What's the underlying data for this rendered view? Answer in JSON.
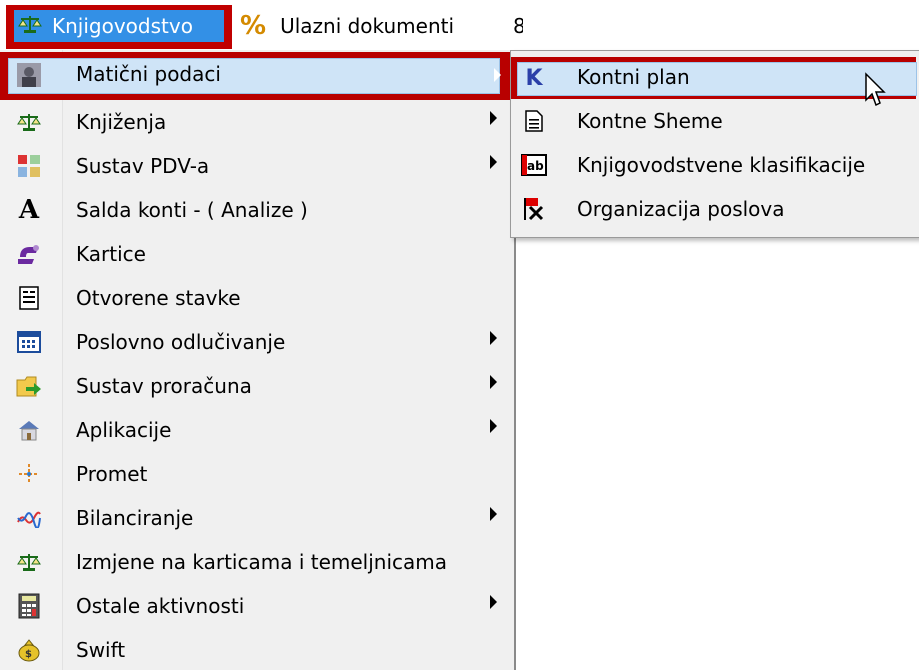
{
  "menubar": {
    "items": [
      {
        "label": "Knjigovodstvo",
        "icon": "scales-icon",
        "selected": true
      },
      {
        "label": "Ulazni dokumenti",
        "icon": "percent-icon",
        "selected": false
      },
      {
        "label": "8",
        "icon": "",
        "selected": false
      }
    ]
  },
  "main_menu": {
    "items": [
      {
        "label": "Matični podaci",
        "icon": "person-icon",
        "submenu": true,
        "highlighted": true
      },
      {
        "label": "Knjiženja",
        "icon": "scales-icon",
        "submenu": true
      },
      {
        "label": "Sustav PDV-a",
        "icon": "tax-icon",
        "submenu": true
      },
      {
        "label": "Salda konti - ( Analize )",
        "icon": "letter-a-icon",
        "submenu": false
      },
      {
        "label": "Kartice",
        "icon": "cards-icon",
        "submenu": false
      },
      {
        "label": "Otvorene stavke",
        "icon": "document-list-icon",
        "submenu": false
      },
      {
        "label": "Poslovno odlučivanje",
        "icon": "calendar-grid-icon",
        "submenu": true
      },
      {
        "label": "Sustav proračuna",
        "icon": "folder-arrow-icon",
        "submenu": true
      },
      {
        "label": "Aplikacije",
        "icon": "house-icon",
        "submenu": true
      },
      {
        "label": "Promet",
        "icon": "crossing-icon",
        "submenu": false
      },
      {
        "label": "Bilanciranje",
        "icon": "wave-chart-icon",
        "submenu": true
      },
      {
        "label": "Izmjene na karticama i temeljnicama",
        "icon": "scales-icon",
        "submenu": false
      },
      {
        "label": "Ostale aktivnosti",
        "icon": "calculator-icon",
        "submenu": true
      },
      {
        "label": "Swift",
        "icon": "money-bag-icon",
        "submenu": false
      }
    ]
  },
  "sub_menu": {
    "items": [
      {
        "label": "Kontni plan",
        "icon": "letter-k-icon",
        "highlighted": true
      },
      {
        "label": "Kontne Sheme",
        "icon": "document-icon"
      },
      {
        "label": "Knjigovodstvene klasifikacije",
        "icon": "abl-icon"
      },
      {
        "label": "Organizacija poslova",
        "icon": "flag-x-icon"
      }
    ]
  },
  "colors": {
    "highlight_border": "#b80000",
    "selection_blue": "#3390e6",
    "hover_fill": "#cfe4f7",
    "menu_bg": "#f0f0f0"
  }
}
